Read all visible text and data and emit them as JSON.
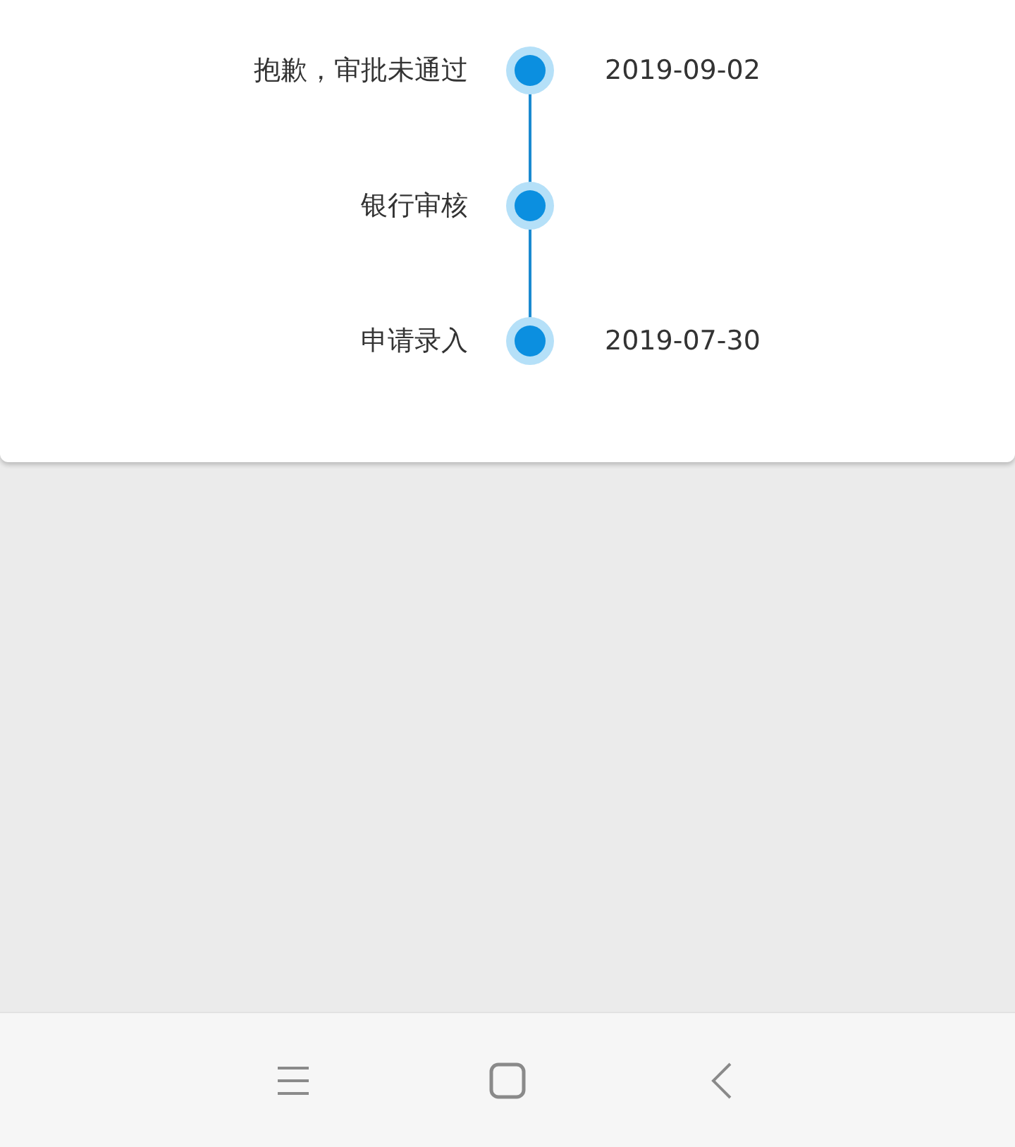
{
  "timeline": [
    {
      "label": "抱歉，审批未通过",
      "date": "2019-09-02"
    },
    {
      "label": "银行审核"
    },
    {
      "label": "申请录入",
      "date": "2019-07-30"
    }
  ]
}
